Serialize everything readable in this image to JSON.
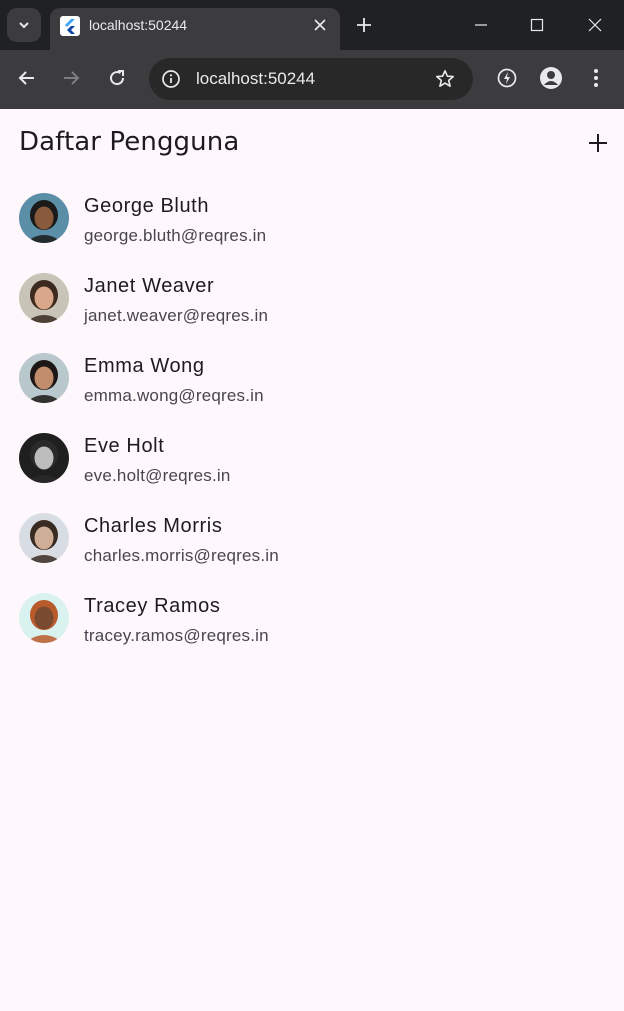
{
  "browser": {
    "tab_title": "localhost:50244",
    "url": "localhost:50244",
    "tab_close_glyph": "✕",
    "new_tab_glyph": "+"
  },
  "app": {
    "title": "Daftar Pengguna",
    "add_icon": "plus-icon"
  },
  "users": [
    {
      "name": "George Bluth",
      "email": "george.bluth@reqres.in",
      "skin": "#8a5a3c",
      "hair": "#1a1a1a",
      "bg": "#5b8fa8"
    },
    {
      "name": "Janet Weaver",
      "email": "janet.weaver@reqres.in",
      "skin": "#d9a88a",
      "hair": "#3b2a1e",
      "bg": "#c9c4b8"
    },
    {
      "name": "Emma Wong",
      "email": "emma.wong@reqres.in",
      "skin": "#c08d6d",
      "hair": "#1c1714",
      "bg": "#b8c8cc"
    },
    {
      "name": "Eve Holt",
      "email": "eve.holt@reqres.in",
      "skin": "#bdbdbd",
      "hair": "#2a2a2a",
      "bg": "#1f1f1f"
    },
    {
      "name": "Charles Morris",
      "email": "charles.morris@reqres.in",
      "skin": "#cfae98",
      "hair": "#3a2b22",
      "bg": "#d8dde3"
    },
    {
      "name": "Tracey Ramos",
      "email": "tracey.ramos@reqres.in",
      "skin": "#7a4a30",
      "hair": "#b85a2a",
      "bg": "#d9f1ef"
    }
  ]
}
